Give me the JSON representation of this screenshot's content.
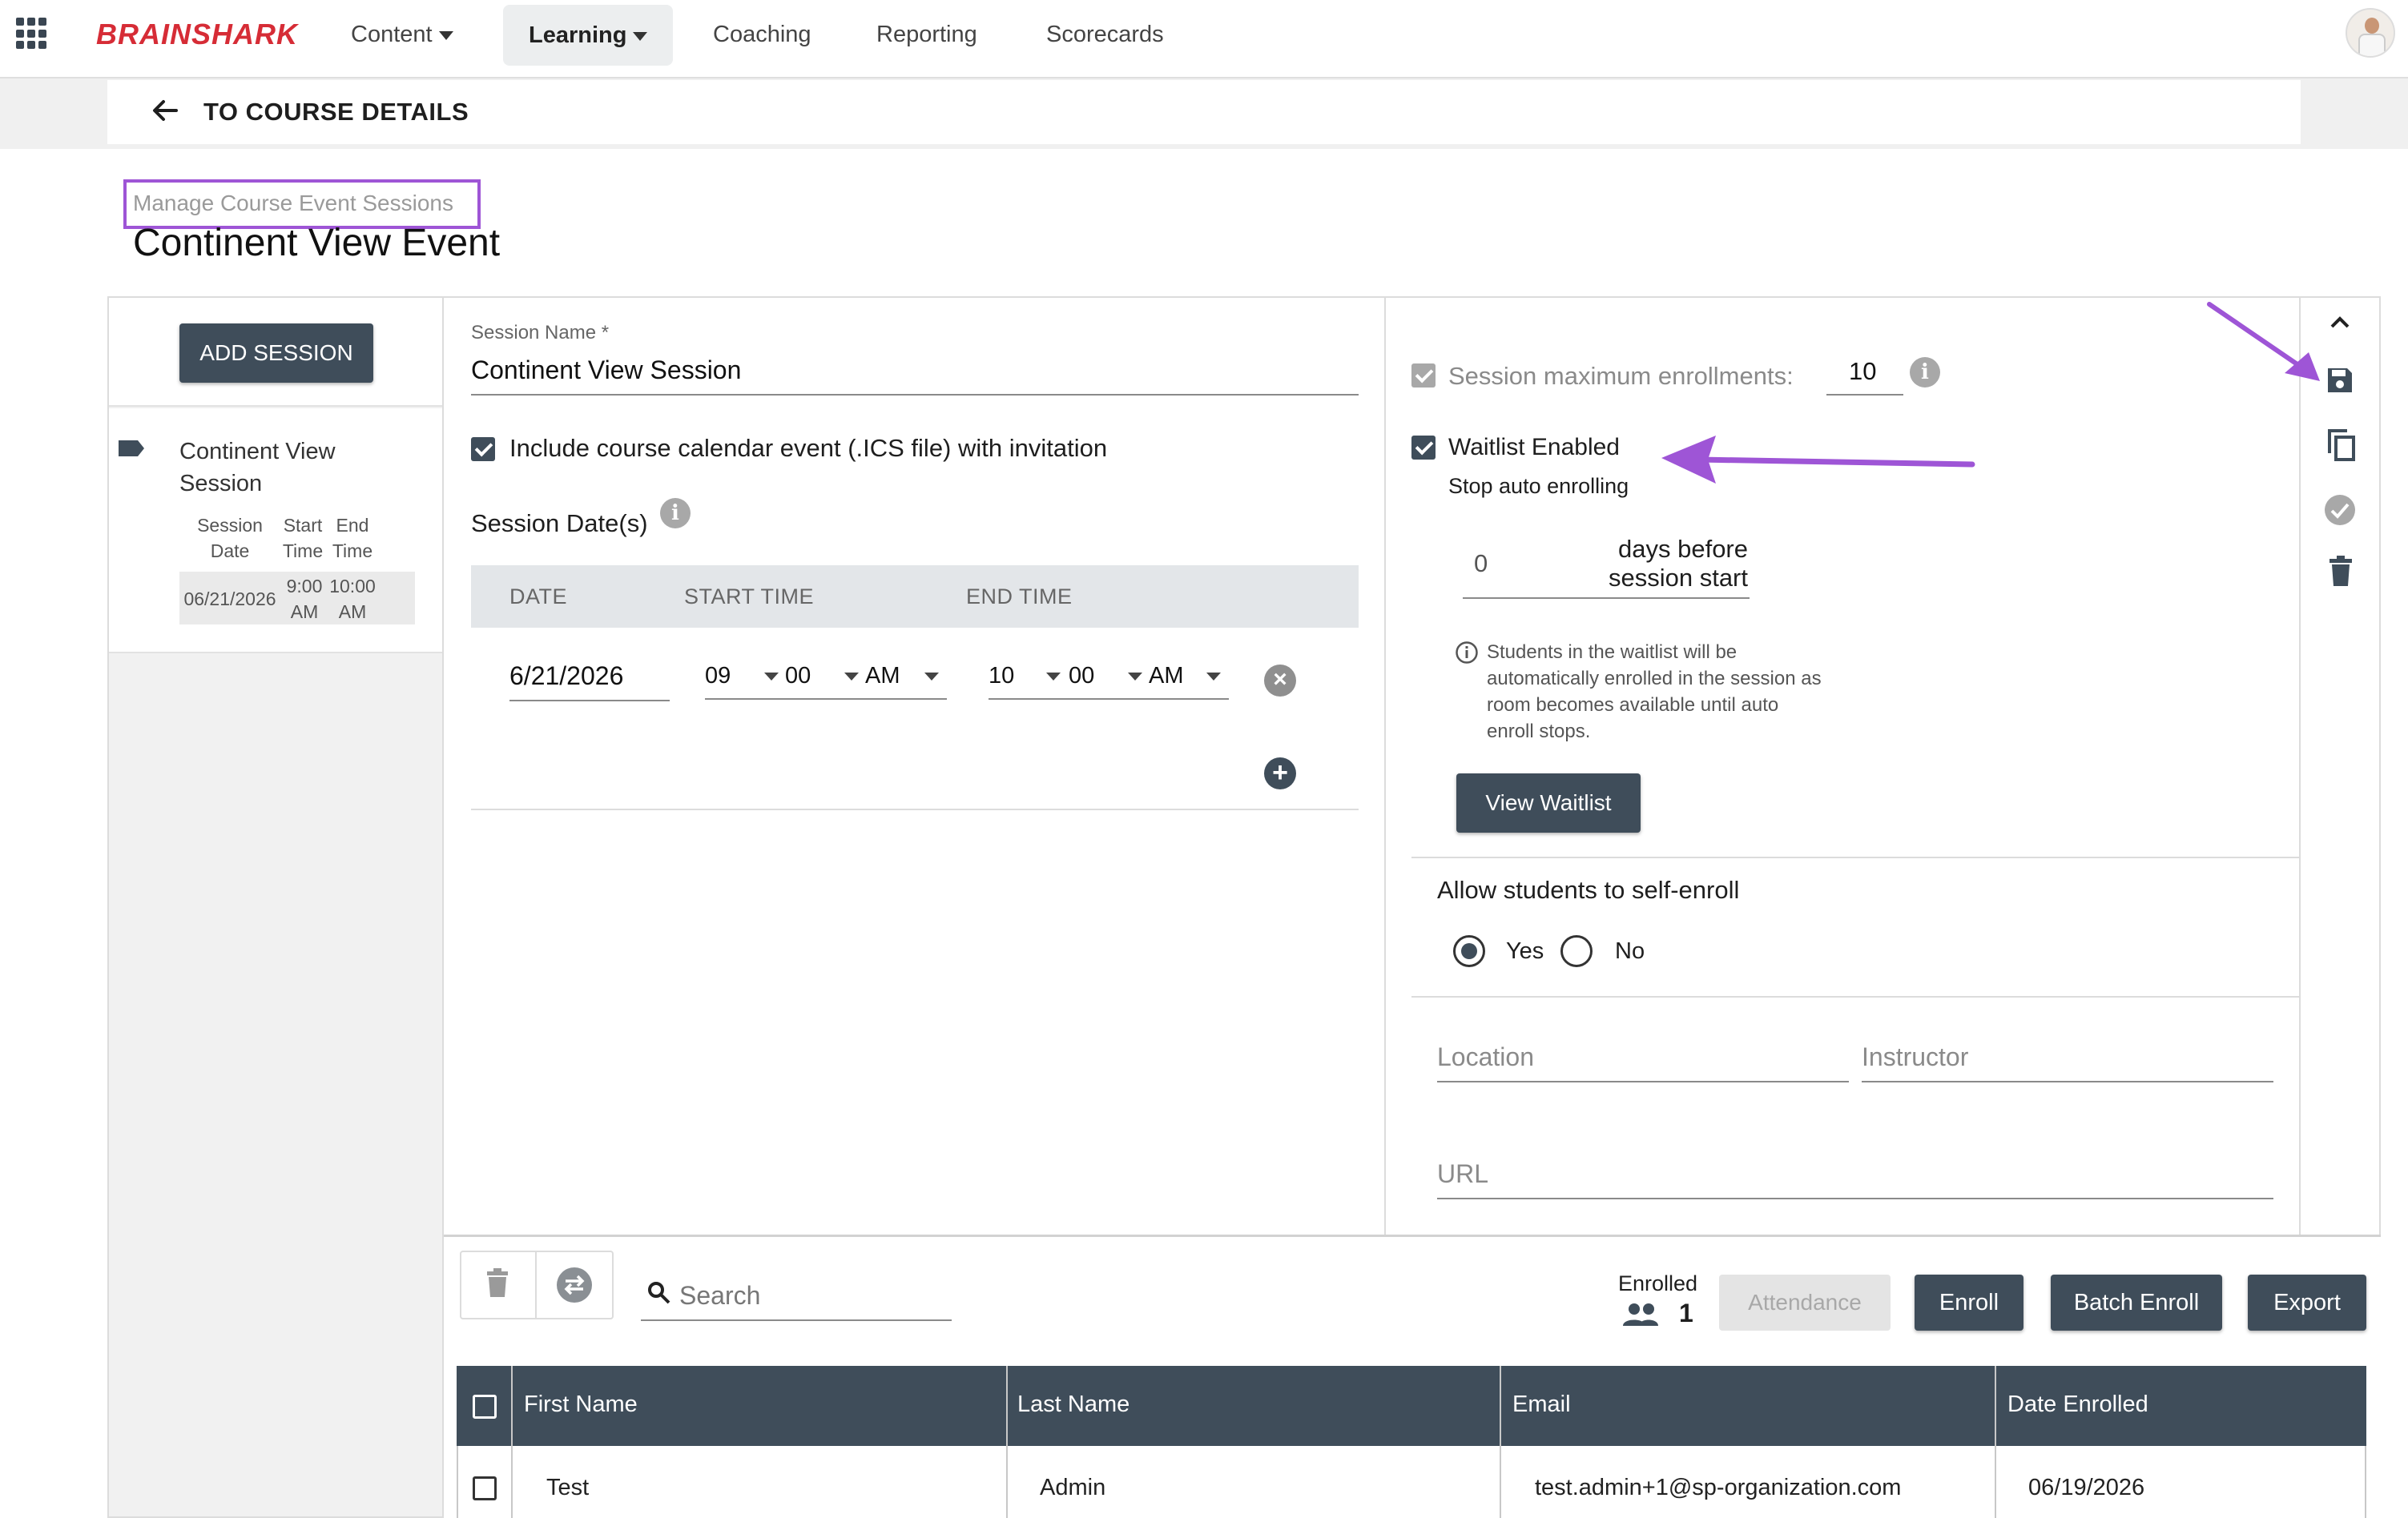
{
  "nav": {
    "brand": "BRAINSHARK",
    "items": [
      {
        "label": "Content"
      },
      {
        "label": "Learning"
      },
      {
        "label": "Coaching"
      },
      {
        "label": "Reporting"
      },
      {
        "label": "Scorecards"
      }
    ]
  },
  "back": {
    "label": "TO COURSE DETAILS"
  },
  "page": {
    "subtitle": "Manage Course Event Sessions",
    "title": "Continent View Event"
  },
  "sessions": {
    "add_label": "ADD SESSION",
    "list": [
      {
        "name": "Continent View Session",
        "headers": [
          "Session Date",
          "Start Time",
          "End Time"
        ],
        "date": "06/21/2026",
        "start": "9:00 AM",
        "end": "10:00 AM"
      }
    ]
  },
  "form": {
    "session_name_label": "Session Name *",
    "session_name": "Continent View Session",
    "ics_label": "Include course calendar event (.ICS file) with invitation",
    "dates_label": "Session Date(s)",
    "date_cols": [
      "DATE",
      "START TIME",
      "END TIME"
    ],
    "date": "6/21/2026",
    "start_hour": "09",
    "start_min": "00",
    "start_ampm": "AM",
    "end_hour": "10",
    "end_min": "00",
    "end_ampm": "AM"
  },
  "settings": {
    "max_enroll_label": "Session maximum enrollments:",
    "max_enroll_value": "10",
    "waitlist_label": "Waitlist Enabled",
    "stop_auto_label": "Stop auto enrolling",
    "days_value": "0",
    "days_label_1": "days before",
    "days_label_2": "session start",
    "waitlist_note": "Students in the waitlist will be automatically enrolled in the session as room becomes available until auto enroll stops.",
    "view_waitlist_label": "View Waitlist",
    "self_enroll_label": "Allow students to self-enroll",
    "yes_label": "Yes",
    "no_label": "No",
    "location_placeholder": "Location",
    "instructor_placeholder": "Instructor",
    "url_placeholder": "URL"
  },
  "toolbar_icons": [
    "chevron-up-icon",
    "save-icon",
    "copy-icon",
    "check-circle-icon",
    "trash-icon"
  ],
  "enroll": {
    "search_placeholder": "Search",
    "enrolled_label": "Enrolled",
    "enrolled_count": "1",
    "attendance_label": "Attendance",
    "enroll_label": "Enroll",
    "batch_label": "Batch Enroll",
    "export_label": "Export",
    "columns": [
      "First Name",
      "Last Name",
      "Email",
      "Date Enrolled"
    ],
    "rows": [
      {
        "first": "Test",
        "last": "Admin",
        "email": "test.admin+1@sp-organization.com",
        "date": "06/19/2026"
      }
    ]
  },
  "colors": {
    "brand": "#d62c36",
    "primary_dark": "#3f4d5a",
    "annotation": "#9e55d6"
  }
}
